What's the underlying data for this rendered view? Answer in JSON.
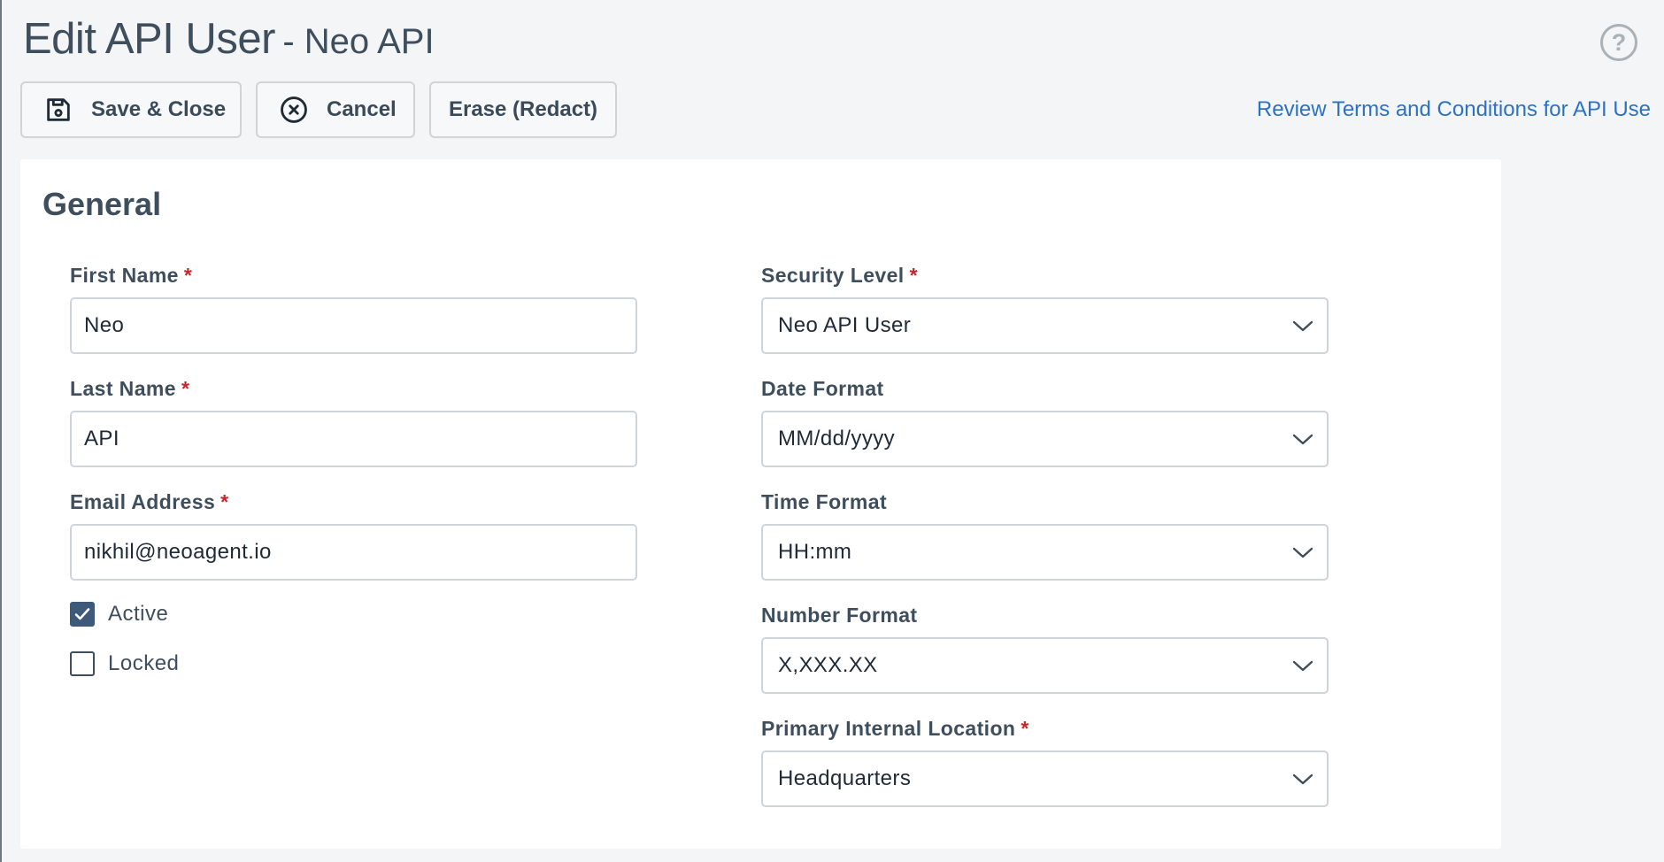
{
  "header": {
    "title": "Edit API User",
    "subtitle": "- Neo API",
    "help_glyph": "?"
  },
  "toolbar": {
    "save_label": "Save & Close",
    "cancel_label": "Cancel",
    "erase_label": "Erase (Redact)"
  },
  "terms_link": "Review Terms and Conditions for API Use",
  "section": {
    "title": "General"
  },
  "form": {
    "required_mark": "*",
    "first_name": {
      "label": "First Name",
      "value": "Neo"
    },
    "last_name": {
      "label": "Last Name",
      "value": "API"
    },
    "email": {
      "label": "Email Address",
      "value": "nikhil@neoagent.io"
    },
    "active": {
      "label": "Active",
      "checked": true
    },
    "locked": {
      "label": "Locked",
      "checked": false
    },
    "security_level": {
      "label": "Security Level",
      "value": "Neo API User"
    },
    "date_format": {
      "label": "Date Format",
      "value": "MM/dd/yyyy"
    },
    "time_format": {
      "label": "Time Format",
      "value": "HH:mm"
    },
    "number_format": {
      "label": "Number Format",
      "value": "X,XXX.XX"
    },
    "primary_location": {
      "label": "Primary Internal Location",
      "value": "Headquarters"
    }
  },
  "colors": {
    "link": "#2c72c4",
    "required": "#c8262b",
    "checkbox_checked": "#3d5a7b",
    "background": "#f4f5f7"
  },
  "icons": {
    "save": "floppy-disk-icon",
    "cancel": "circle-x-icon",
    "help": "question-circle-icon",
    "select": "chevron-down-icon",
    "check": "check-icon"
  }
}
